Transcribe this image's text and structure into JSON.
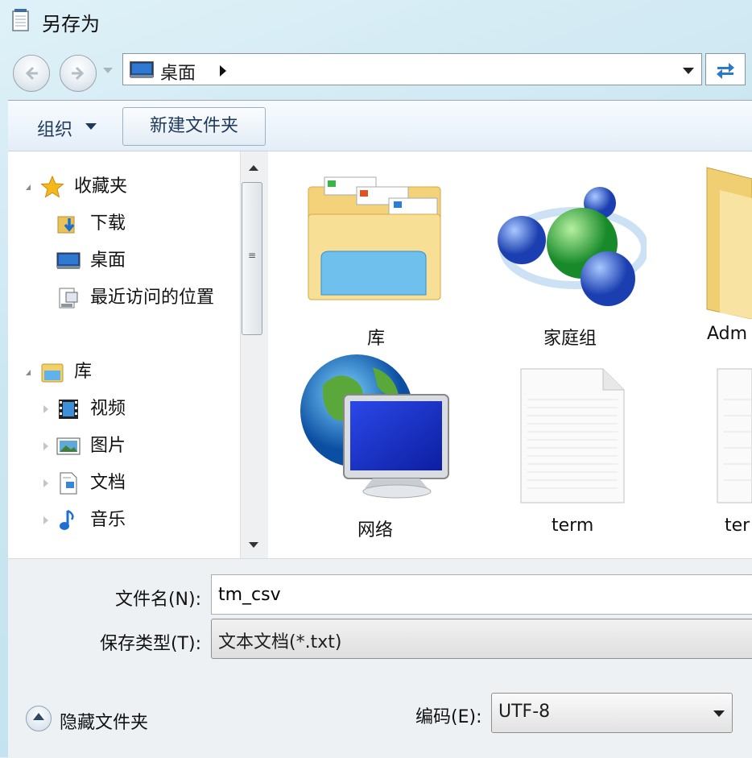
{
  "window": {
    "title": "另存为",
    "icon": "notepad-icon"
  },
  "address": {
    "path": "桌面",
    "icon": "desktop-icon"
  },
  "toolbar": {
    "organize": "组织",
    "new_folder": "新建文件夹"
  },
  "nav": {
    "favorites": {
      "label": "收藏夹",
      "icon": "star-icon"
    },
    "favorite_items": [
      {
        "label": "下载",
        "icon": "download-folder-icon"
      },
      {
        "label": "桌面",
        "icon": "desktop-icon"
      },
      {
        "label": "最近访问的位置",
        "icon": "recent-places-icon"
      }
    ],
    "libraries": {
      "label": "库",
      "icon": "libraries-icon"
    },
    "library_items": [
      {
        "label": "视频",
        "icon": "video-icon"
      },
      {
        "label": "图片",
        "icon": "picture-icon"
      },
      {
        "label": "文档",
        "icon": "document-icon"
      },
      {
        "label": "音乐",
        "icon": "music-icon"
      }
    ]
  },
  "files": [
    {
      "label": "库",
      "icon": "libraries-folder-icon"
    },
    {
      "label": "家庭组",
      "icon": "homegroup-icon"
    },
    {
      "label": "Adm",
      "icon": "user-folder-icon"
    },
    {
      "label": "网络",
      "icon": "network-icon"
    },
    {
      "label": "term",
      "icon": "text-file-icon"
    },
    {
      "label": "ter",
      "icon": "text-file-icon"
    }
  ],
  "form": {
    "filename_label": "文件名(N):",
    "filename_value": "tm_csv",
    "filetype_label": "保存类型(T):",
    "filetype_value": "文本文档(*.txt)",
    "hide_folders": "隐藏文件夹",
    "encoding_label": "编码(E):",
    "encoding_value": "UTF-8"
  }
}
